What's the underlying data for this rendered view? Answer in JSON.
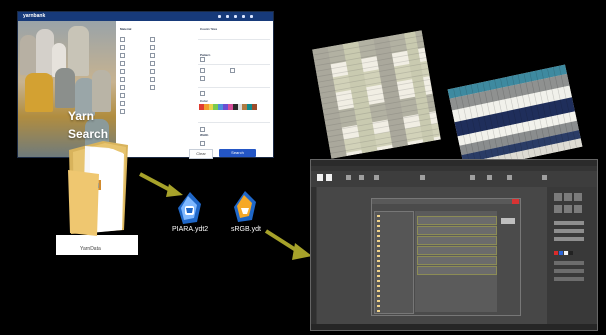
{
  "yarn_search_window": {
    "app_logo": "yarnbank",
    "title_line1": "Yarn",
    "title_line2": "Search",
    "buttons": {
      "search": "Search",
      "clear": "Clear"
    },
    "form_sections": [
      "Material",
      "Count / Size",
      "Color",
      "Pattern",
      "Width"
    ],
    "swatch_colors": [
      "#e03b2f",
      "#f29d2a",
      "#e9d44a",
      "#7acb4f",
      "#4e8fdc",
      "#6a4fd2",
      "#d64f9a",
      "#2b2b2b",
      "#dcdcdc",
      "#b07b42",
      "#0f8b8d",
      "#9b4b2a"
    ]
  },
  "folder": {
    "label": "YarnData"
  },
  "files": [
    {
      "name": "PIARA.ydt2",
      "icon": "yarn-file-icon"
    },
    {
      "name": "sRGB.ydt",
      "icon": "yarn-file-icon"
    }
  ],
  "fabrics": [
    {
      "name": "plaid-fabric-icon"
    },
    {
      "name": "striped-fabric-icon"
    }
  ],
  "app_window": {
    "title": "",
    "status": ""
  },
  "colors": {
    "accent_blue": "#2456c5",
    "arrow_olive": "#a7a22a",
    "dark_bg": "#000000"
  }
}
